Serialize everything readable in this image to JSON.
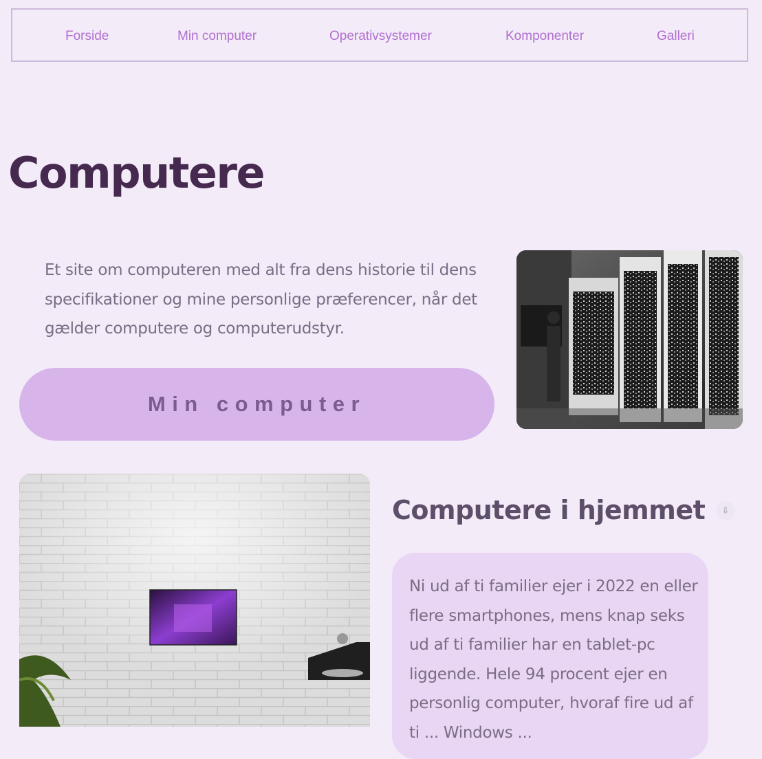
{
  "nav": {
    "items": [
      {
        "label": "Forside"
      },
      {
        "label": "Min computer"
      },
      {
        "label": "Operativsystemer"
      },
      {
        "label": "Komponenter"
      },
      {
        "label": "Galleri"
      }
    ]
  },
  "hero": {
    "title": "Computere",
    "intro": "Et site om computeren med alt fra dens historie til dens specifikationer og mine personlige præferencer, når det gælder computere og computerudstyr.",
    "cta_label": "Min computer"
  },
  "home_section": {
    "heading": "Computere i hjemmet",
    "body": "Ni ud af ti familier ejer i 2022 en eller flere smartphones, mens knap seks ud af ti familier har en tablet-pc liggende. Hele 94 procent ejer en personlig computer, hvoraf fire ud af ti ... Windows ..."
  },
  "icons": {
    "scroll": "download-arrow-icon"
  },
  "colors": {
    "background": "#f3ebf8",
    "nav_link": "#b06fd0",
    "title": "#46294f",
    "cta_bg": "#d7b5eb",
    "card_bg": "#e8d6f4"
  }
}
